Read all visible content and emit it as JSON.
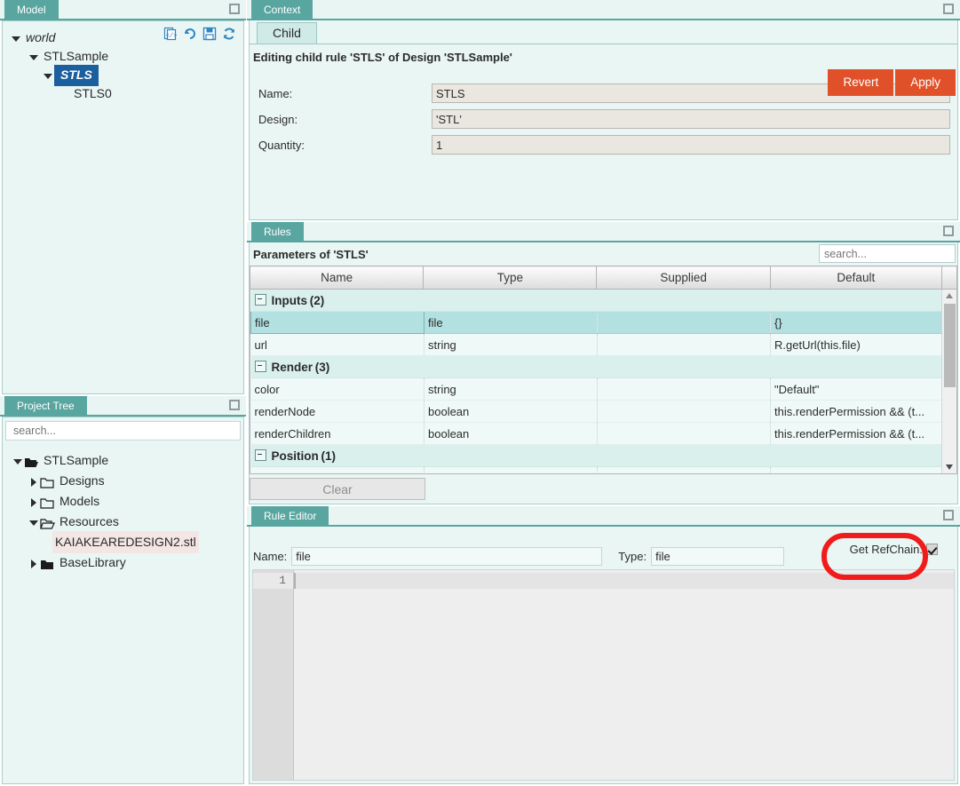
{
  "model_panel": {
    "tab_label": "Model",
    "minimize_icon": "minimize-icon",
    "toolbar": [
      {
        "name": "code-view-icon",
        "title": "Code"
      },
      {
        "name": "undo-icon",
        "title": "Undo"
      },
      {
        "name": "save-icon",
        "title": "Save"
      },
      {
        "name": "refresh-icon",
        "title": "Refresh"
      }
    ],
    "tree": [
      {
        "label": "world",
        "indent": 0,
        "caret": "down",
        "style": "italic"
      },
      {
        "label": "STLSample",
        "indent": 1,
        "caret": "down",
        "style": "normal"
      },
      {
        "label": "STLS",
        "indent": 2,
        "caret": "down",
        "style": "selected"
      },
      {
        "label": "STLS0",
        "indent": 3,
        "caret": "none",
        "style": "normal"
      }
    ]
  },
  "project_panel": {
    "tab_label": "Project Tree",
    "search": {
      "value": "",
      "placeholder": "search..."
    },
    "tree": [
      {
        "label": "STLSample",
        "indent": 0,
        "caret": "down",
        "icon": "folder-open-icon",
        "highlight": false
      },
      {
        "label": "Designs",
        "indent": 1,
        "caret": "right",
        "icon": "folder-icon",
        "highlight": false
      },
      {
        "label": "Models",
        "indent": 1,
        "caret": "right",
        "icon": "folder-icon",
        "highlight": false
      },
      {
        "label": "Resources",
        "indent": 1,
        "caret": "down",
        "icon": "folder-open-icon",
        "highlight": false
      },
      {
        "label": "KAIAKEAREDESIGN2.stl",
        "indent": 2,
        "caret": "none",
        "icon": "none",
        "highlight": true
      },
      {
        "label": "BaseLibrary",
        "indent": 1,
        "caret": "right",
        "icon": "folder-solid-icon",
        "highlight": false
      }
    ]
  },
  "context_panel": {
    "tab_label": "Context",
    "sub_tab_label": "Child",
    "title": "Editing child rule 'STLS' of Design 'STLSample'",
    "revert_label": "Revert",
    "apply_label": "Apply",
    "fields": [
      {
        "label": "Name:",
        "value": "STLS"
      },
      {
        "label": "Design:",
        "value": "'STL'"
      },
      {
        "label": "Quantity:",
        "value": "1"
      }
    ]
  },
  "rules_panel": {
    "tab_label": "Rules",
    "title": "Parameters of 'STLS'",
    "search": {
      "value": "",
      "placeholder": "search..."
    },
    "columns": [
      "Name",
      "Type",
      "Supplied",
      "Default"
    ],
    "rows": [
      {
        "kind": "group",
        "label": "Inputs",
        "count": "(2)"
      },
      {
        "kind": "data",
        "selected": true,
        "name": "file",
        "type": "file",
        "supplied": "",
        "default": "{}"
      },
      {
        "kind": "data",
        "selected": false,
        "name": "url",
        "type": "string",
        "supplied": "",
        "default": "R.getUrl(this.file)"
      },
      {
        "kind": "group",
        "label": "Render",
        "count": "(3)"
      },
      {
        "kind": "data",
        "selected": false,
        "name": "color",
        "type": "string",
        "supplied": "",
        "default": "\"Default\""
      },
      {
        "kind": "data",
        "selected": false,
        "name": "renderNode",
        "type": "boolean",
        "supplied": "",
        "default": "this.renderPermission && (t..."
      },
      {
        "kind": "data",
        "selected": false,
        "name": "renderChildren",
        "type": "boolean",
        "supplied": "",
        "default": "this.renderPermission && (t..."
      },
      {
        "kind": "group",
        "label": "Position",
        "count": "(1)"
      }
    ],
    "clear_label": "Clear"
  },
  "rule_editor_panel": {
    "tab_label": "Rule Editor",
    "name_label": "Name:",
    "name_value": "file",
    "type_label": "Type:",
    "type_value": "file",
    "refchain_label": "Get RefChain:",
    "refchain_checked": true,
    "line_numbers": [
      "1"
    ],
    "code": ""
  },
  "annotation": {
    "shape": "rounded-rectangle",
    "color": "#f01c1c",
    "target": "Get RefChain checkbox"
  }
}
